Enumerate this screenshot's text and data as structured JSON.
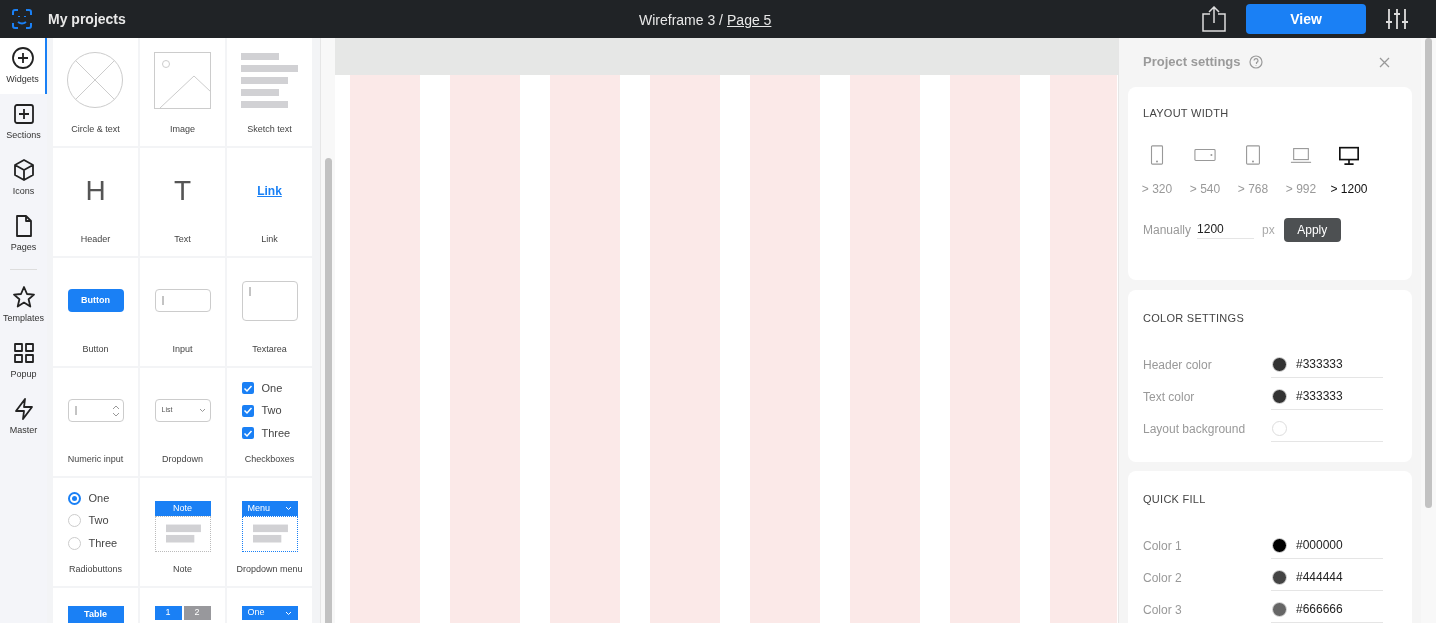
{
  "topbar": {
    "home": "My projects",
    "project": "Wireframe 3 /",
    "page": "Page 5",
    "view_button": "View"
  },
  "rail": [
    {
      "kind": "plus-circle",
      "label": "Widgets",
      "selected": true
    },
    {
      "kind": "plus-square",
      "label": "Sections",
      "selected": false
    },
    {
      "kind": "cube",
      "label": "Icons",
      "selected": false
    },
    {
      "kind": "page",
      "label": "Pages",
      "selected": false
    },
    {
      "kind": "star",
      "label": "Templates",
      "selected": false
    },
    {
      "kind": "grid",
      "label": "Popup",
      "selected": false
    },
    {
      "kind": "bolt",
      "label": "Master",
      "selected": false
    }
  ],
  "widgets": [
    {
      "kind": "circle",
      "label": "Circle & text"
    },
    {
      "kind": "image",
      "label": "Image"
    },
    {
      "kind": "sketch",
      "label": "Sketch text"
    },
    {
      "kind": "glyph",
      "label": "Header",
      "glyph": "H"
    },
    {
      "kind": "glyph",
      "label": "Text",
      "glyph": "T"
    },
    {
      "kind": "link",
      "label": "Link",
      "text": "Link"
    },
    {
      "kind": "button",
      "label": "Button",
      "text": "Button"
    },
    {
      "kind": "input",
      "label": "Input"
    },
    {
      "kind": "textarea",
      "label": "Textarea"
    },
    {
      "kind": "numeric",
      "label": "Numeric input"
    },
    {
      "kind": "dropdown",
      "label": "Dropdown",
      "text": "List"
    },
    {
      "kind": "checkboxes",
      "label": "Checkboxes",
      "options": [
        {
          "text": "One",
          "checked": true
        },
        {
          "text": "Two",
          "checked": true
        },
        {
          "text": "Three",
          "checked": true
        }
      ]
    },
    {
      "kind": "radios",
      "label": "Radiobuttons",
      "options": [
        {
          "text": "One",
          "selected": true
        },
        {
          "text": "Two",
          "selected": false
        },
        {
          "text": "Three",
          "selected": false
        }
      ]
    },
    {
      "kind": "note",
      "label": "Note",
      "text": "Note"
    },
    {
      "kind": "menu",
      "label": "Dropdown menu",
      "text": "Menu"
    },
    {
      "kind": "table",
      "text": "Table"
    },
    {
      "kind": "pages",
      "pages": [
        "1",
        "2"
      ]
    },
    {
      "kind": "select",
      "text": "One"
    }
  ],
  "settings": {
    "title": "Project settings",
    "layout": {
      "heading": "LAYOUT WIDTH",
      "devices": [
        {
          "kind": "phone",
          "label": "> 320",
          "selected": false
        },
        {
          "kind": "phone-land",
          "label": "> 540",
          "selected": false
        },
        {
          "kind": "tablet",
          "label": "> 768",
          "selected": false
        },
        {
          "kind": "laptop",
          "label": "> 992",
          "selected": false
        },
        {
          "kind": "desktop",
          "label": "> 1200",
          "selected": true
        }
      ],
      "manual_label": "Manually",
      "manual_value": "1200",
      "unit": "px",
      "apply": "Apply"
    },
    "color_settings": {
      "heading": "COLOR SETTINGS",
      "rows": [
        {
          "label": "Header color",
          "value": "#333333",
          "color": "#333333"
        },
        {
          "label": "Text color",
          "value": "#333333",
          "color": "#333333"
        },
        {
          "label": "Layout background",
          "color": "#ffffff"
        }
      ]
    },
    "quick_fill": {
      "heading": "QUICK FILL",
      "rows": [
        {
          "label": "Color 1",
          "value": "#000000",
          "color": "#000000"
        },
        {
          "label": "Color 2",
          "value": "#444444",
          "color": "#444444"
        },
        {
          "label": "Color 3",
          "value": "#666666",
          "color": "#666666"
        }
      ]
    }
  }
}
